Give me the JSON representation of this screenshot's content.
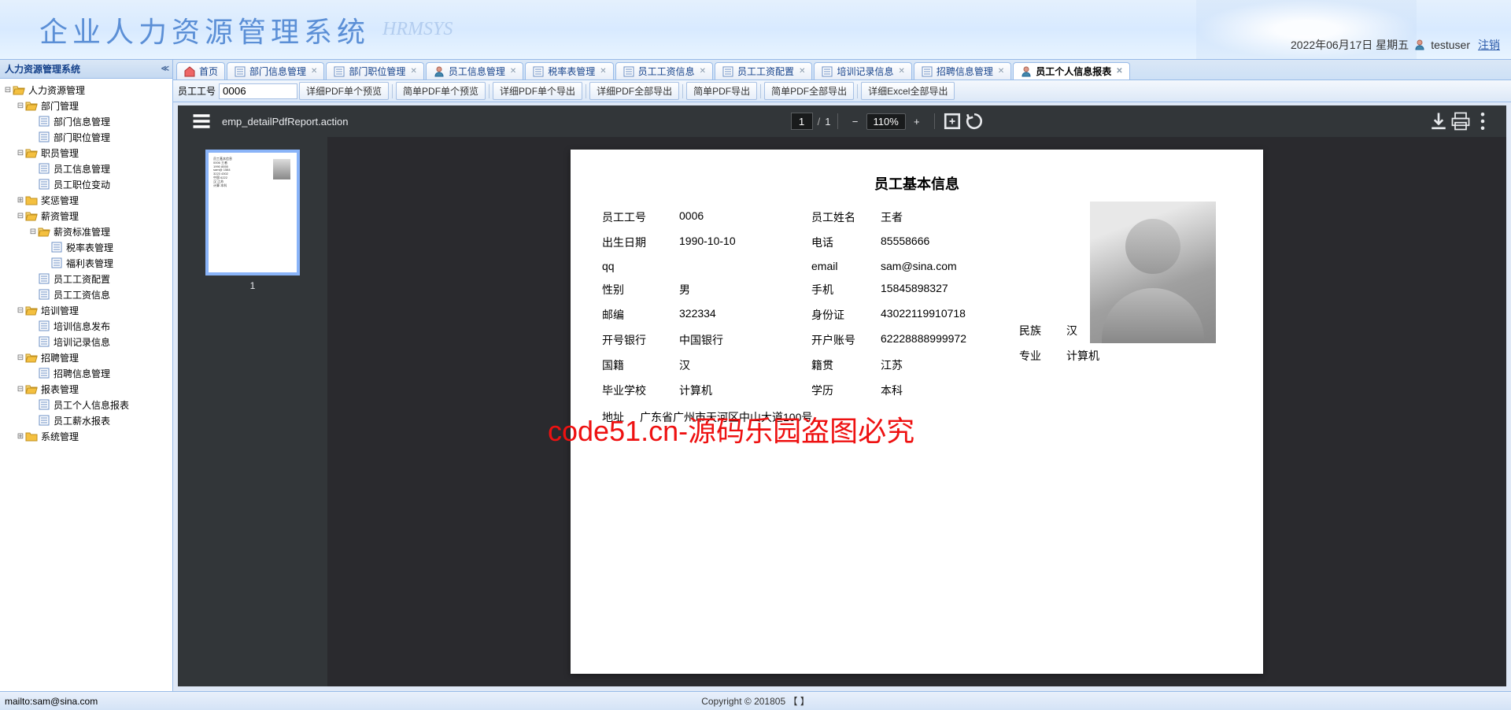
{
  "header": {
    "title_cn": "企业人力资源管理系统",
    "title_en": "HRMSYS",
    "date": "2022年06月17日 星期五",
    "username": "testuser",
    "logout": "注销"
  },
  "sidebar": {
    "title": "人力资源管理系统",
    "nodes": [
      {
        "label": "人力资源管理",
        "type": "folder",
        "indent": 0,
        "expanded": true
      },
      {
        "label": "部门管理",
        "type": "folder",
        "indent": 1,
        "expanded": true
      },
      {
        "label": "部门信息管理",
        "type": "leaf",
        "indent": 2
      },
      {
        "label": "部门职位管理",
        "type": "leaf",
        "indent": 2
      },
      {
        "label": "职员管理",
        "type": "folder",
        "indent": 1,
        "expanded": true
      },
      {
        "label": "员工信息管理",
        "type": "leaf",
        "indent": 2
      },
      {
        "label": "员工职位变动",
        "type": "leaf",
        "indent": 2
      },
      {
        "label": "奖惩管理",
        "type": "folder",
        "indent": 1,
        "expanded": false
      },
      {
        "label": "薪资管理",
        "type": "folder",
        "indent": 1,
        "expanded": true
      },
      {
        "label": "薪资标准管理",
        "type": "folder",
        "indent": 2,
        "expanded": true
      },
      {
        "label": "税率表管理",
        "type": "leaf",
        "indent": 3
      },
      {
        "label": "福利表管理",
        "type": "leaf",
        "indent": 3
      },
      {
        "label": "员工工资配置",
        "type": "leaf",
        "indent": 2
      },
      {
        "label": "员工工资信息",
        "type": "leaf",
        "indent": 2
      },
      {
        "label": "培训管理",
        "type": "folder",
        "indent": 1,
        "expanded": true
      },
      {
        "label": "培训信息发布",
        "type": "leaf",
        "indent": 2
      },
      {
        "label": "培训记录信息",
        "type": "leaf",
        "indent": 2
      },
      {
        "label": "招聘管理",
        "type": "folder",
        "indent": 1,
        "expanded": true
      },
      {
        "label": "招聘信息管理",
        "type": "leaf",
        "indent": 2
      },
      {
        "label": "报表管理",
        "type": "folder",
        "indent": 1,
        "expanded": true
      },
      {
        "label": "员工个人信息报表",
        "type": "leaf",
        "indent": 2
      },
      {
        "label": "员工薪水报表",
        "type": "leaf",
        "indent": 2
      },
      {
        "label": "系统管理",
        "type": "folder",
        "indent": 1,
        "expanded": false
      }
    ]
  },
  "tabs": [
    {
      "label": "首页",
      "icon": "home",
      "closable": false,
      "active": false
    },
    {
      "label": "部门信息管理",
      "icon": "grid",
      "closable": true,
      "active": false
    },
    {
      "label": "部门职位管理",
      "icon": "doc",
      "closable": true,
      "active": false
    },
    {
      "label": "员工信息管理",
      "icon": "user",
      "closable": true,
      "active": false
    },
    {
      "label": "税率表管理",
      "icon": "table",
      "closable": true,
      "active": false
    },
    {
      "label": "员工工资信息",
      "icon": "money",
      "closable": true,
      "active": false
    },
    {
      "label": "员工工资配置",
      "icon": "gear",
      "closable": true,
      "active": false
    },
    {
      "label": "培训记录信息",
      "icon": "list",
      "closable": true,
      "active": false
    },
    {
      "label": "招聘信息管理",
      "icon": "list2",
      "closable": true,
      "active": false
    },
    {
      "label": "员工个人信息报表",
      "icon": "report",
      "closable": true,
      "active": true
    }
  ],
  "action_bar": {
    "emp_no_label": "员工工号",
    "emp_no_value": "0006",
    "buttons": [
      "详细PDF单个预览",
      "简单PDF单个预览",
      "详细PDF单个导出",
      "详细PDF全部导出",
      "简单PDF导出",
      "简单PDF全部导出",
      "详细Excel全部导出"
    ]
  },
  "pdf_viewer": {
    "filename": "emp_detailPdfReport.action",
    "page_current": "1",
    "page_total": "1",
    "zoom": "110%",
    "thumb_label": "1"
  },
  "document": {
    "title": "员工基本信息",
    "fields": {
      "emp_no": {
        "label": "员工工号",
        "value": "0006"
      },
      "emp_name": {
        "label": "员工姓名",
        "value": "王者"
      },
      "birth": {
        "label": "出生日期",
        "value": "1990-10-10"
      },
      "phone": {
        "label": "电话",
        "value": "85558666"
      },
      "qq": {
        "label": "qq",
        "value": ""
      },
      "email": {
        "label": "email",
        "value": "sam@sina.com"
      },
      "gender": {
        "label": "性别",
        "value": "男"
      },
      "mobile": {
        "label": "手机",
        "value": "15845898327"
      },
      "zip": {
        "label": "邮编",
        "value": "322334"
      },
      "idcard": {
        "label": "身份证",
        "value": "43022119910718"
      },
      "bank": {
        "label": "开号银行",
        "value": "中国银行"
      },
      "account": {
        "label": "开户账号",
        "value": "62228888999972"
      },
      "nation": {
        "label": "国籍",
        "value": "汉"
      },
      "native": {
        "label": "籍贯",
        "value": "江苏"
      },
      "ethnic": {
        "label": "民族",
        "value": "汉"
      },
      "school": {
        "label": "毕业学校",
        "value": "计算机"
      },
      "degree": {
        "label": "学历",
        "value": "本科"
      },
      "major": {
        "label": "专业",
        "value": "计算机"
      },
      "address": {
        "label": "地址",
        "value": "广东省广州市天河区中山大道100号"
      }
    }
  },
  "watermark": "code51.cn-源码乐园盗图必究",
  "footer": {
    "copyright": "Copyright © 201805 【 】",
    "status": "mailto:sam@sina.com"
  }
}
